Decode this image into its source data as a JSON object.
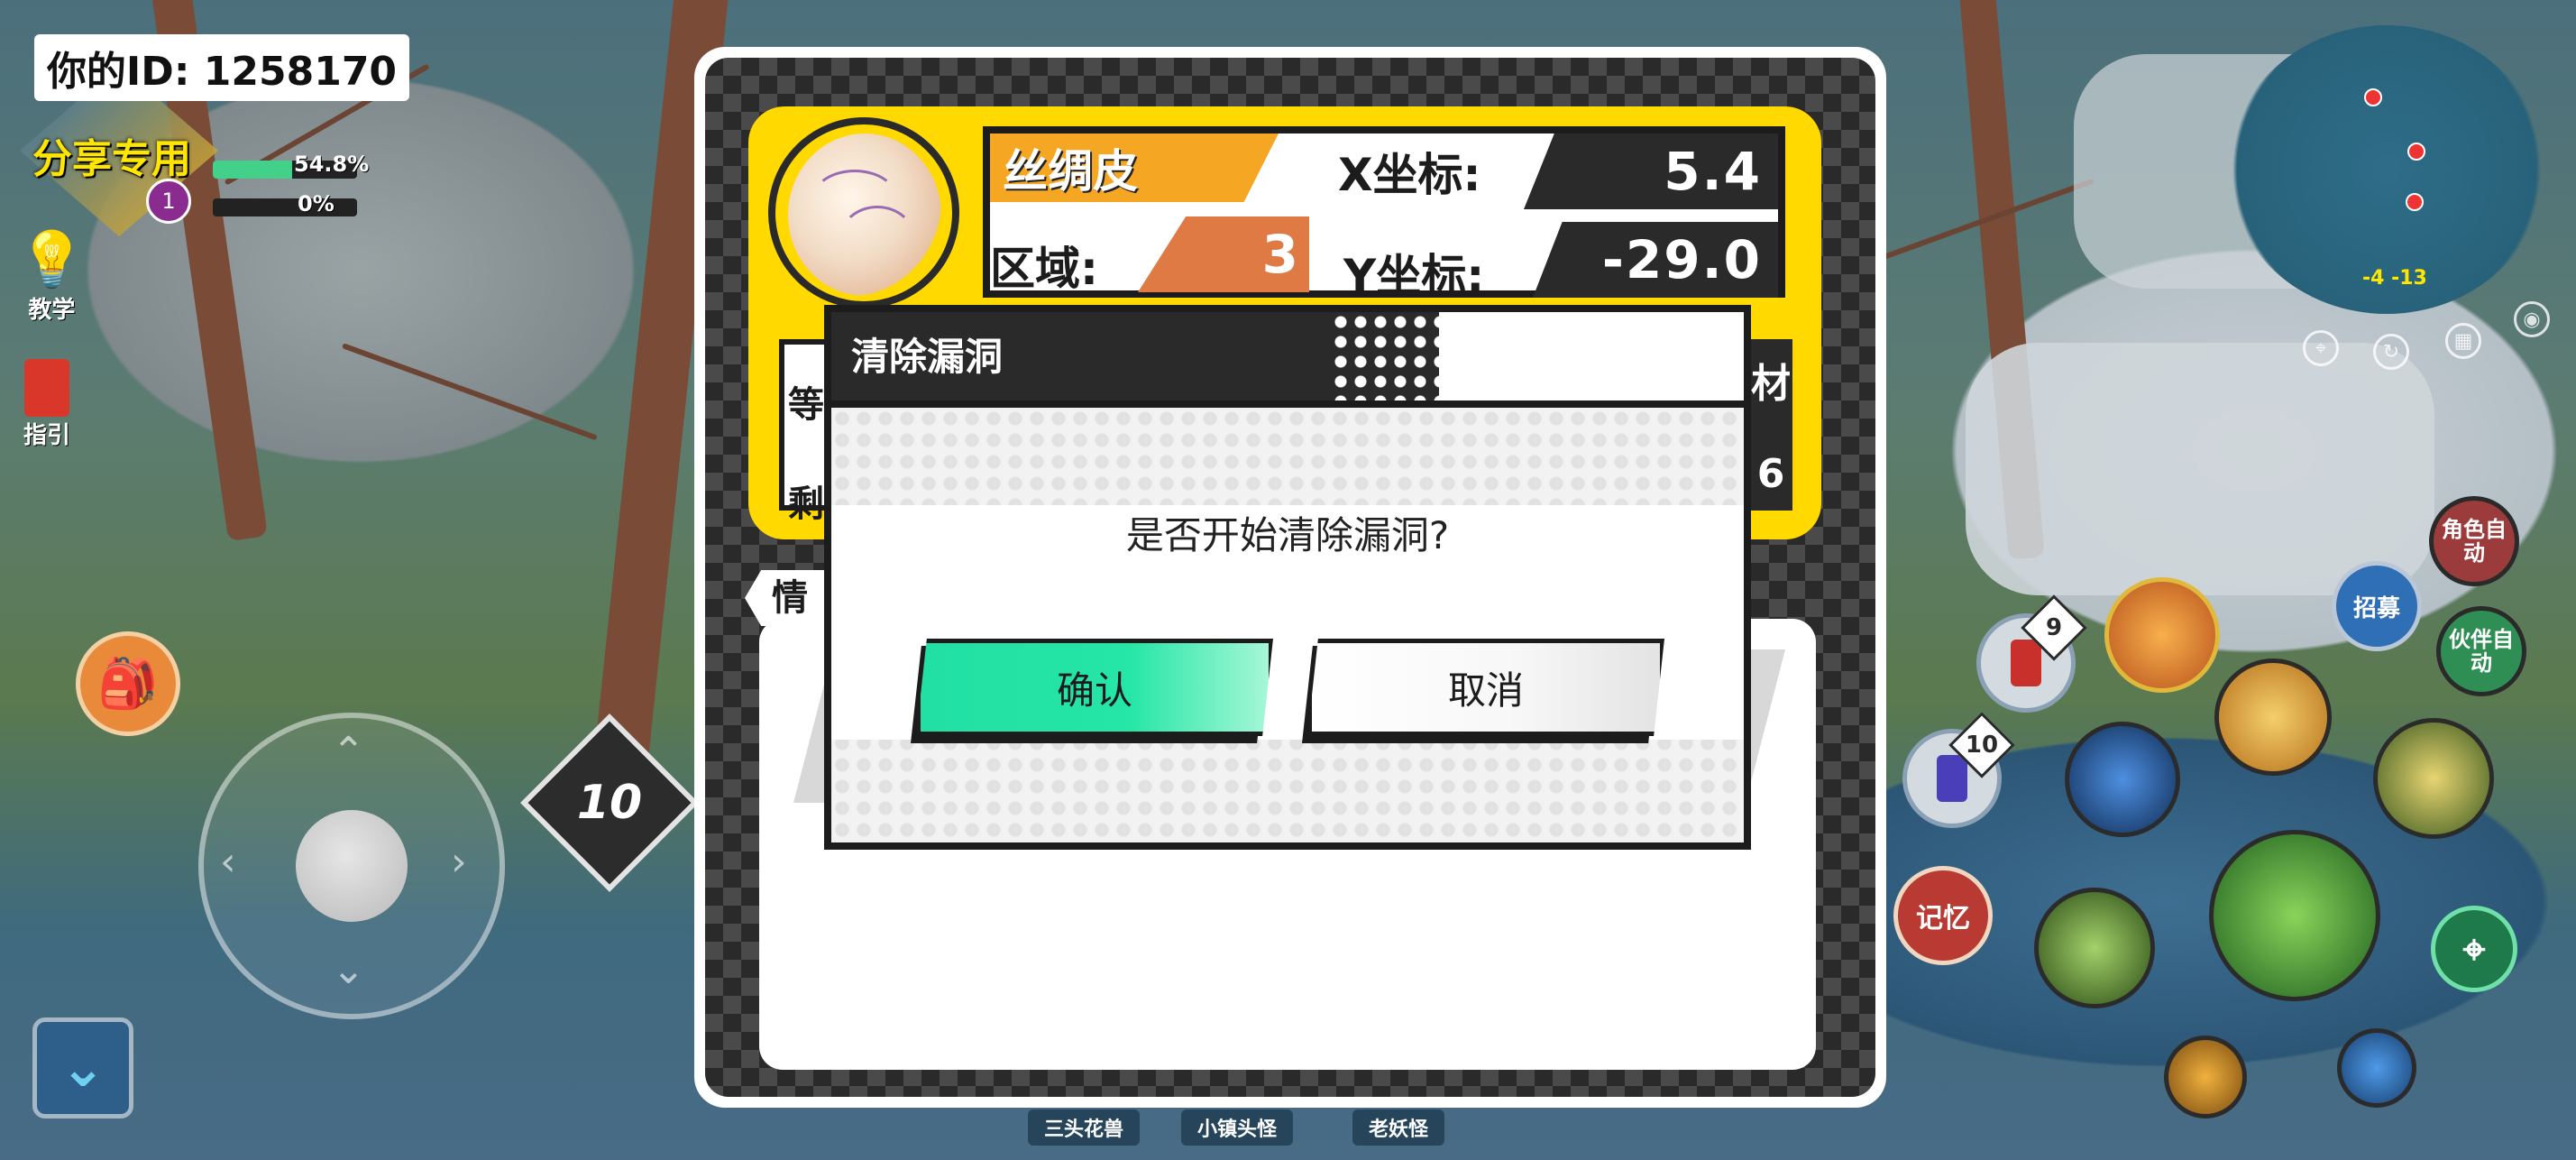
{
  "hud": {
    "player_id": "你的ID: 1258170",
    "share_label": "分享专用",
    "level": "1",
    "exp_percent": "54.8%",
    "exp_fill": 0.548,
    "second_percent": "0%",
    "second_fill": 0.0,
    "tutorial_label": "教学",
    "guide_label": "指引",
    "stage_level": "10"
  },
  "minimap": {
    "coords": "-4 -13"
  },
  "item_panel": {
    "item_name": "丝绸皮",
    "x_label": "X坐标:",
    "x_value": "5.4",
    "region_label": "区域:",
    "region_value": "3",
    "y_label": "Y坐标:",
    "y_value": "-29.0",
    "row1_left_partial": "等",
    "row2_left_partial": "剩",
    "row1_right_partial": "材",
    "row2_right_partial": "6",
    "tab_label_partial": "情"
  },
  "dialog": {
    "title": "清除漏洞",
    "message": "是否开始清除漏洞?",
    "confirm_label": "确认",
    "cancel_label": "取消"
  },
  "skills": {
    "role_auto": "角色自动",
    "partner_auto": "伙伴自动",
    "summon": "招募",
    "memory": "记忆",
    "potion_red_count": "9",
    "potion_blue_count": "10"
  },
  "bottom_tabs": [
    "三头花兽",
    "小镇头怪",
    "老妖怪"
  ],
  "colors": {
    "panel_yellow": "#ffd900",
    "confirm_green": "#22e0a3",
    "name_orange": "#f5a623",
    "region_orange": "#e07a45"
  }
}
